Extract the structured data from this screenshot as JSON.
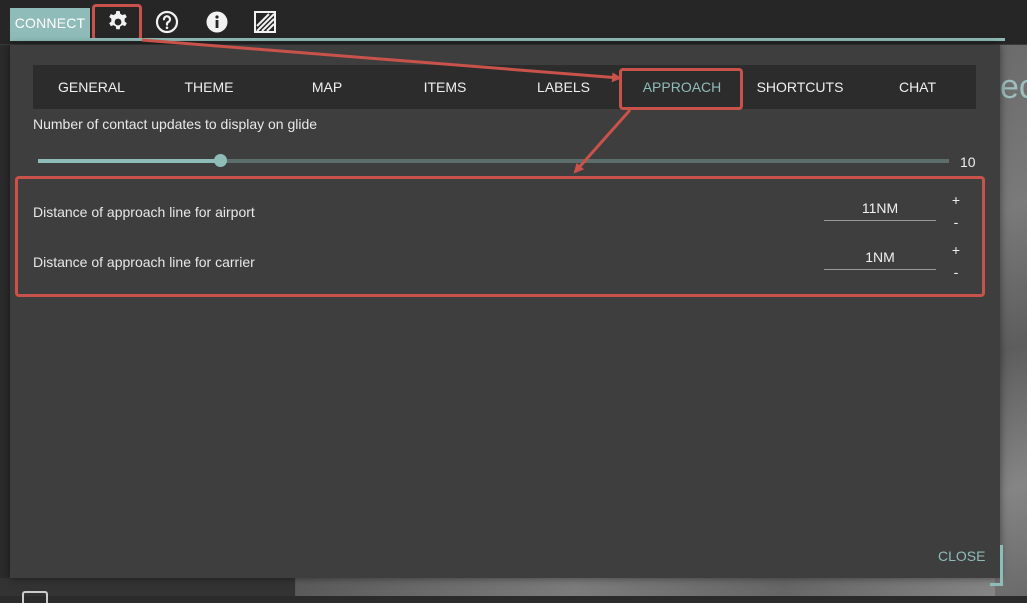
{
  "toolbar": {
    "connect_label": "CONNECT",
    "icons": [
      "gear-icon",
      "help-icon",
      "info-icon",
      "layers-icon"
    ]
  },
  "background": {
    "title_fragment": "ect"
  },
  "settings": {
    "tabs": [
      {
        "label": "GENERAL"
      },
      {
        "label": "THEME"
      },
      {
        "label": "MAP"
      },
      {
        "label": "ITEMS"
      },
      {
        "label": "LABELS"
      },
      {
        "label": "APPROACH"
      },
      {
        "label": "SHORTCUTS"
      },
      {
        "label": "CHAT"
      }
    ],
    "active_tab": "APPROACH",
    "glide": {
      "label": "Number of contact updates to display on glide",
      "value": "10",
      "fraction": 0.2
    },
    "approach_rows": [
      {
        "label": "Distance of approach line for airport",
        "value": "11NM",
        "plus": "+",
        "minus": "-"
      },
      {
        "label": "Distance of approach line for carrier",
        "value": "1NM",
        "plus": "+",
        "minus": "-"
      }
    ],
    "close_label": "CLOSE"
  },
  "colors": {
    "accent": "#8fbcb8",
    "annotation": "#c9524a",
    "dialog_bg": "#3e3e3e",
    "tabbar_bg": "#2c2c2c"
  }
}
